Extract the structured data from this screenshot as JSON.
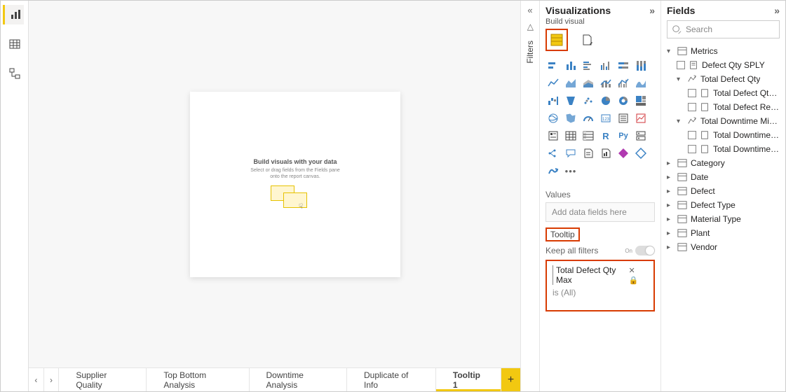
{
  "left_rail": {
    "icons": [
      "bar-chart",
      "table",
      "model"
    ]
  },
  "canvas": {
    "empty_title": "Build visuals with your data",
    "empty_sub_line1": "Select or drag fields from the Fields pane",
    "empty_sub_line2": "onto the report canvas."
  },
  "tabs": {
    "prev": "‹",
    "next": "›",
    "items": [
      "Supplier Quality",
      "Top Bottom Analysis",
      "Downtime Analysis",
      "Duplicate of Info",
      "Tooltip 1"
    ],
    "active_index": 4,
    "add": "+"
  },
  "filters_strip": {
    "label": "Filters"
  },
  "viz_pane": {
    "title": "Visualizations",
    "subtitle": "Build visual",
    "values_label": "Values",
    "values_placeholder": "Add data fields here",
    "tooltip_label": "Tooltip",
    "keep_filters_label": "Keep all filters",
    "keep_filters_state": "On",
    "filter_name": "Total Defect Qty Max",
    "filter_state": "is (All)"
  },
  "fields_pane": {
    "title": "Fields",
    "search_placeholder": "Search",
    "metrics_label": "Metrics",
    "metrics": {
      "defect_qty_sply": "Defect Qty SPLY",
      "total_defect_qty": "Total Defect Qty",
      "total_defect_qty_a": "Total Defect Qty ...",
      "total_defect_rep": "Total Defect Rep...",
      "total_downtime_min": "Total Downtime Min...",
      "total_downtime_a": "Total Downtime ...",
      "total_downtime_b": "Total Downtime ..."
    },
    "tables": [
      "Category",
      "Date",
      "Defect",
      "Defect Type",
      "Material Type",
      "Plant",
      "Vendor"
    ]
  }
}
